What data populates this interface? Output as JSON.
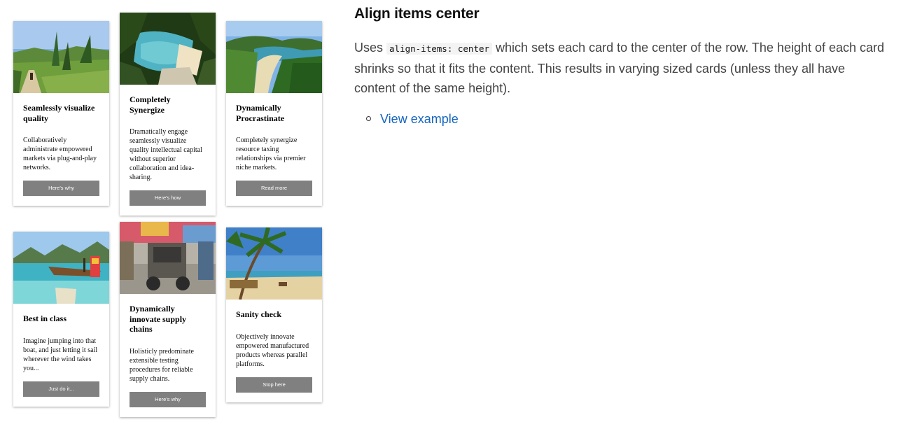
{
  "section": {
    "title": "Align items center",
    "description": {
      "prefix": "Uses",
      "code": "align-items: center",
      "suffix": "which sets each card to the center of the row. The height of each card shrinks so that it fits the content. This results in varying sized cards (unless they all have content of the same height)."
    },
    "links": [
      {
        "label": "View example"
      }
    ]
  },
  "cards": [
    {
      "title": "Seamlessly visualize quality",
      "text": "Collaboratively administrate empowered markets via plug-and-play networks.",
      "button": "Here's why",
      "image": "photo-path-through-tropical-plants"
    },
    {
      "title": "Completely Synergize",
      "text": "Dramatically engage seamlessly visualize quality intellectual capital without superior collaboration and idea-sharing.",
      "button": "Here's how",
      "image": "photo-beach-cove-through-trees"
    },
    {
      "title": "Dynamically Procrastinate",
      "text": "Completely synergize resource taxing relationships via premier niche markets.",
      "button": "Read more",
      "image": "photo-beach-bay-with-jungle"
    },
    {
      "title": "Best in class",
      "text": "Imagine jumping into that boat, and just letting it sail wherever the wind takes you...",
      "button": "Just do it...",
      "image": "photo-longtail-boat-turquoise-sea"
    },
    {
      "title": "Dynamically innovate supply chains",
      "text": "Holisticly predominate extensible testing procedures for reliable supply chains.",
      "button": "Here's why",
      "image": "photo-tuk-tuk-street-scene"
    },
    {
      "title": "Sanity check",
      "text": "Objectively innovate empowered manufactured products whereas parallel platforms.",
      "button": "Stop here",
      "image": "photo-palm-trees-sandy-beach"
    }
  ]
}
